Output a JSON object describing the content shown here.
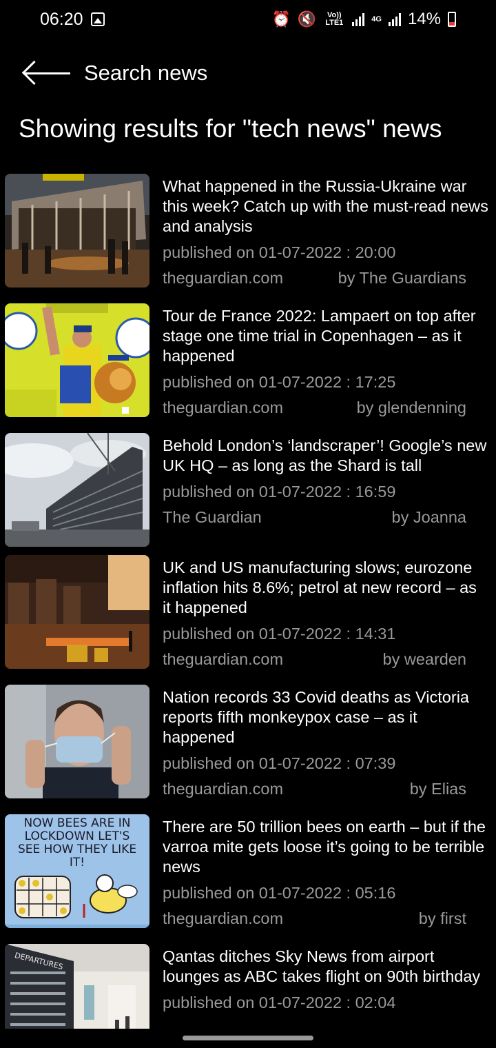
{
  "status_bar": {
    "time": "06:20",
    "volte": "Vo)) LTE1",
    "network": "4G",
    "battery": "14%",
    "icons": [
      "image-icon",
      "alarm-icon",
      "mute-icon",
      "volte-icon",
      "signal-icon",
      "4g-icon",
      "battery-icon"
    ]
  },
  "header": {
    "title": "Search news"
  },
  "results_heading": "Showing results for \"tech news\" news",
  "articles": [
    {
      "headline": "What happened in the Russia-Ukraine war this week? Catch up with the must-read news and analysis",
      "date": "published on 01-07-2022 : 20:00",
      "source": "theguardian.com",
      "author": "by The Guardians",
      "thumb_desc": "burnt building with firefighters"
    },
    {
      "headline": "Tour de France 2022: Lampaert on top after stage one time trial in Copenhagen – as it happened",
      "date": "published on 01-07-2022 : 17:25",
      "source": "theguardian.com",
      "author": "by glendenning",
      "thumb_desc": "cyclist in yellow jersey with lion mascot"
    },
    {
      "headline": "Behold London’s ‘landscraper’! Google’s new UK HQ – as long as the Shard is tall",
      "date": "published on 01-07-2022 : 16:59",
      "source": "The Guardian",
      "author": "by Joanna",
      "thumb_desc": "building under construction"
    },
    {
      "headline": "UK and US manufacturing slows; eurozone inflation hits 8.6%; petrol at new record – as it happened",
      "date": "published on 01-07-2022 : 14:31",
      "source": "theguardian.com",
      "author": "by wearden",
      "thumb_desc": "steel factory interior"
    },
    {
      "headline": "Nation records 33 Covid deaths as Victoria reports fifth monkeypox case – as it happened",
      "date": "published on 01-07-2022 : 07:39",
      "source": "theguardian.com",
      "author": "by Elias",
      "thumb_desc": "man adjusting face mask"
    },
    {
      "headline": "There are 50 trillion bees on earth – but if the varroa mite gets loose it’s going to be terrible news",
      "date": "published on 01-07-2022 : 05:16",
      "source": "theguardian.com",
      "author": "by first",
      "thumb_desc": "cartoon bee",
      "cartoon_text": "NOW BEES ARE IN LOCKDOWN LET'S SEE HOW THEY LIKE IT!"
    },
    {
      "headline": "Qantas ditches Sky News from airport lounges as ABC takes flight on 90th birthday",
      "date": "published on 01-07-2022 : 02:04",
      "source": "",
      "author": "",
      "thumb_desc": "airport departures board",
      "board_text": "DEPARTURES"
    }
  ]
}
